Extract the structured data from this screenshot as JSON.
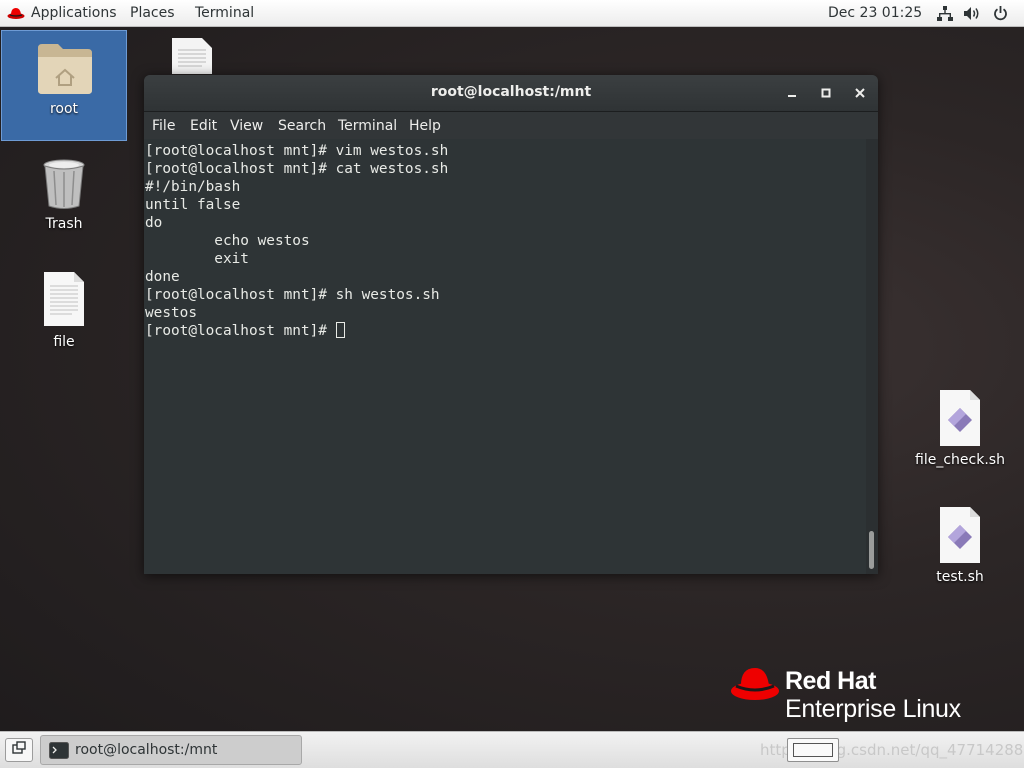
{
  "topbar": {
    "applications": "Applications",
    "places": "Places",
    "terminal": "Terminal",
    "clock": "Dec 23  01:25",
    "icons": [
      "network-icon",
      "volume-icon",
      "power-icon"
    ]
  },
  "desktop": {
    "root_label": "root",
    "trash_label": "Trash",
    "file_label": "file",
    "file_check_label": "file_check.sh",
    "test_label": "test.sh"
  },
  "window": {
    "title": "root@localhost:/mnt",
    "menu": {
      "file": "File",
      "edit": "Edit",
      "view": "View",
      "search": "Search",
      "terminal": "Terminal",
      "help": "Help"
    },
    "lines": [
      "[root@localhost mnt]# vim westos.sh",
      "[root@localhost mnt]# cat westos.sh",
      "#!/bin/bash",
      "until false",
      "do",
      "        echo westos",
      "        exit",
      "done",
      "[root@localhost mnt]# sh westos.sh",
      "westos",
      "[root@localhost mnt]# "
    ]
  },
  "logo": {
    "brand": "Red Hat",
    "product": "Enterprise Linux",
    "color": "#ee0000"
  },
  "taskbar": {
    "task_label": "root@localhost:/mnt",
    "watermark": "https://blog.csdn.net/qq_47714288"
  }
}
